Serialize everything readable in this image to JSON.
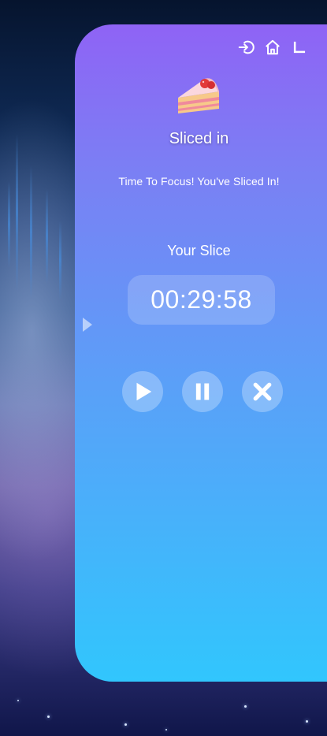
{
  "header": {
    "icons": [
      "logout-icon",
      "home-icon",
      "corner-icon"
    ]
  },
  "session": {
    "emoji": "cake-slice",
    "title": "Sliced in",
    "subtitle": "Time To Focus! You've Sliced In!"
  },
  "timer": {
    "label": "Your Slice",
    "value": "00:29:58"
  },
  "controls": {
    "play": "play-icon",
    "pause": "pause-icon",
    "stop": "close-icon"
  },
  "colors": {
    "panel_top": "#8f63f5",
    "panel_bottom": "#31c6fd",
    "text": "#ffffff"
  }
}
